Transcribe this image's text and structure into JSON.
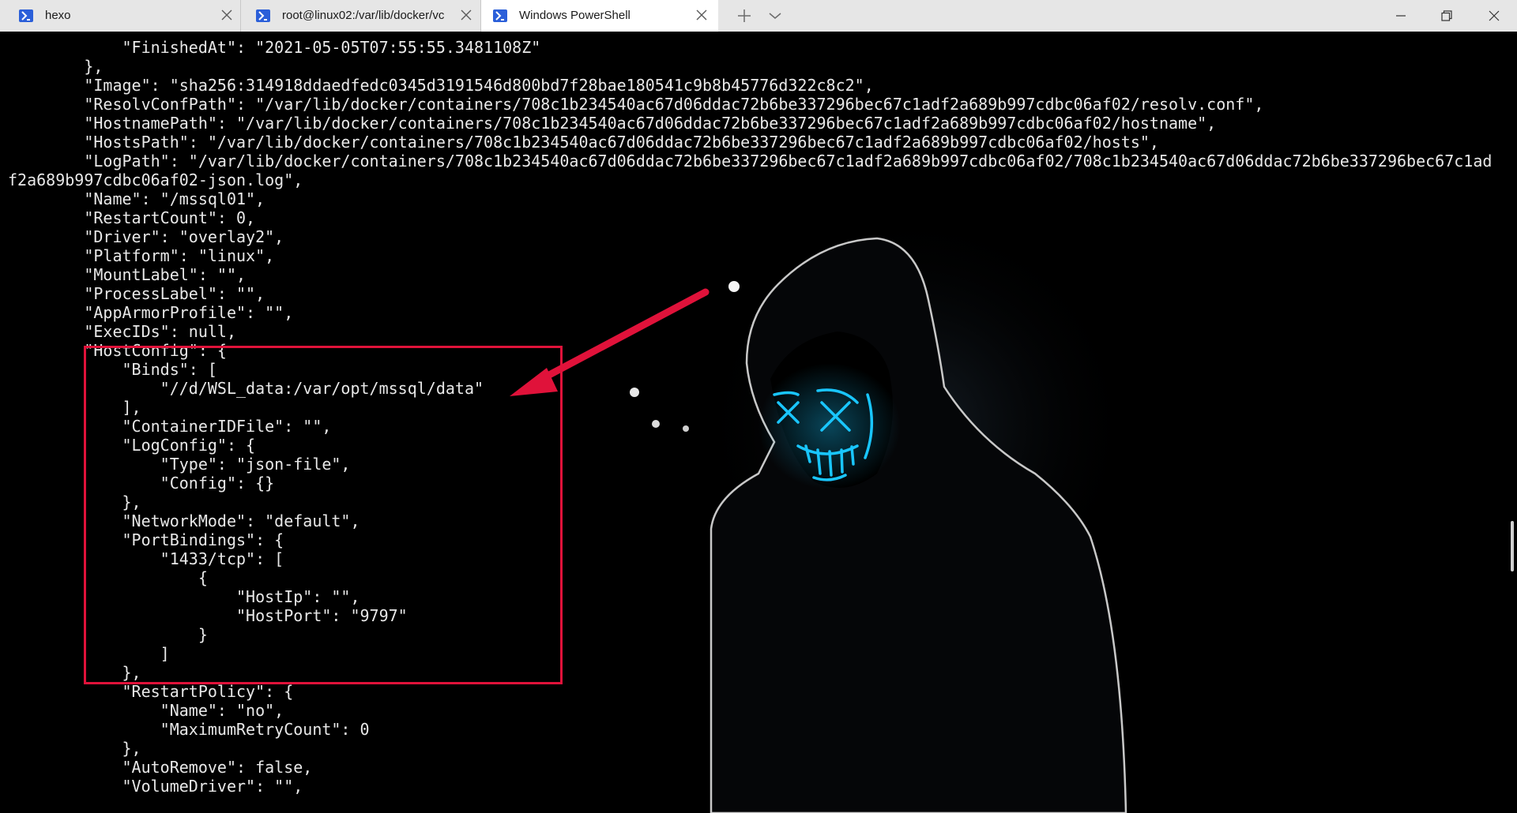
{
  "tabs": [
    {
      "label": "hexo",
      "icon": "powershell-icon"
    },
    {
      "label": "root@linux02:/var/lib/docker/vc",
      "icon": "powershell-icon"
    },
    {
      "label": "Windows PowerShell",
      "icon": "powershell-icon",
      "active": true
    }
  ],
  "tabbar": {
    "new_tab_icon": "plus-icon",
    "dropdown_icon": "chevron-down-icon",
    "minimize_icon": "minimize-icon",
    "restore_icon": "restore-icon",
    "close_icon": "close-icon"
  },
  "terminal": {
    "lines": [
      "            \"FinishedAt\": \"2021-05-05T07:55:55.3481108Z\"",
      "        },",
      "        \"Image\": \"sha256:314918ddaedfedc0345d3191546d800bd7f28bae180541c9b8b45776d322c8c2\",",
      "        \"ResolvConfPath\": \"/var/lib/docker/containers/708c1b234540ac67d06ddac72b6be337296bec67c1adf2a689b997cdbc06af02/resolv.conf\",",
      "        \"HostnamePath\": \"/var/lib/docker/containers/708c1b234540ac67d06ddac72b6be337296bec67c1adf2a689b997cdbc06af02/hostname\",",
      "        \"HostsPath\": \"/var/lib/docker/containers/708c1b234540ac67d06ddac72b6be337296bec67c1adf2a689b997cdbc06af02/hosts\",",
      "        \"LogPath\": \"/var/lib/docker/containers/708c1b234540ac67d06ddac72b6be337296bec67c1adf2a689b997cdbc06af02/708c1b234540ac67d06ddac72b6be337296bec67c1ad",
      "f2a689b997cdbc06af02-json.log\",",
      "        \"Name\": \"/mssql01\",",
      "        \"RestartCount\": 0,",
      "        \"Driver\": \"overlay2\",",
      "        \"Platform\": \"linux\",",
      "        \"MountLabel\": \"\",",
      "        \"ProcessLabel\": \"\",",
      "        \"AppArmorProfile\": \"\",",
      "        \"ExecIDs\": null,",
      "        \"HostConfig\": {",
      "            \"Binds\": [",
      "                \"//d/WSL_data:/var/opt/mssql/data\"",
      "            ],",
      "            \"ContainerIDFile\": \"\",",
      "            \"LogConfig\": {",
      "                \"Type\": \"json-file\",",
      "                \"Config\": {}",
      "            },",
      "            \"NetworkMode\": \"default\",",
      "            \"PortBindings\": {",
      "                \"1433/tcp\": [",
      "                    {",
      "                        \"HostIp\": \"\",",
      "                        \"HostPort\": \"9797\"",
      "                    }",
      "                ]",
      "            },",
      "            \"RestartPolicy\": {",
      "                \"Name\": \"no\",",
      "                \"MaximumRetryCount\": 0",
      "            },",
      "            \"AutoRemove\": false,",
      "            \"VolumeDriver\": \"\","
    ]
  },
  "colors": {
    "tabbar_bg": "#e6e6e6",
    "active_tab_bg": "#ffffff",
    "terminal_bg": "#000000",
    "terminal_text": "#e8e8e8",
    "annotation": "#e0123a",
    "mask_glow": "#19c6ff"
  }
}
